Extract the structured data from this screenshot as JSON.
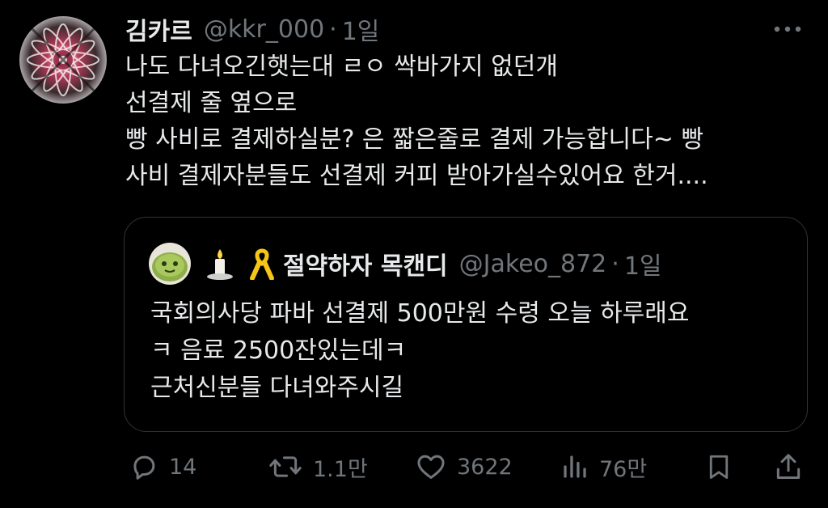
{
  "post": {
    "author_name": "김카르",
    "author_handle": "@kkr_000",
    "separator": "·",
    "time": "1일",
    "lines": [
      "나도 다녀오긴햇는대 ㄹㅇ 싹바가지 없던개",
      "선결제 줄 옆으로",
      "빵 사비로 결제하실분? 은 짧은줄로 결제 가능합니다~ 빵",
      "사비 결제자분들도 선결제 커피 받아가실수있어요 한거...."
    ]
  },
  "quote": {
    "author_name": "절약하자 목캔디",
    "author_handle": "@Jakeo_872",
    "separator": "·",
    "time": "1일",
    "lines": [
      "국회의사당 파바 선결제 500만원 수령 오늘 하루래요",
      "ㅋ 음료 2500잔있는데ㅋ",
      "근처신분들 다녀와주시길"
    ]
  },
  "actions": {
    "reply": {
      "icon": "reply-icon",
      "count": "14"
    },
    "repost": {
      "icon": "repost-icon",
      "count": "1.1만"
    },
    "like": {
      "icon": "heart-icon",
      "count": "3622"
    },
    "views": {
      "icon": "views-icon",
      "count": "76만"
    },
    "bookmark": {
      "icon": "bookmark-icon"
    },
    "share": {
      "icon": "share-icon"
    }
  },
  "colors": {
    "background": "#000000",
    "primary_text": "#e7e9ea",
    "secondary_text": "#71767b",
    "border": "#2f3336",
    "ribbon": "#f5c518"
  }
}
